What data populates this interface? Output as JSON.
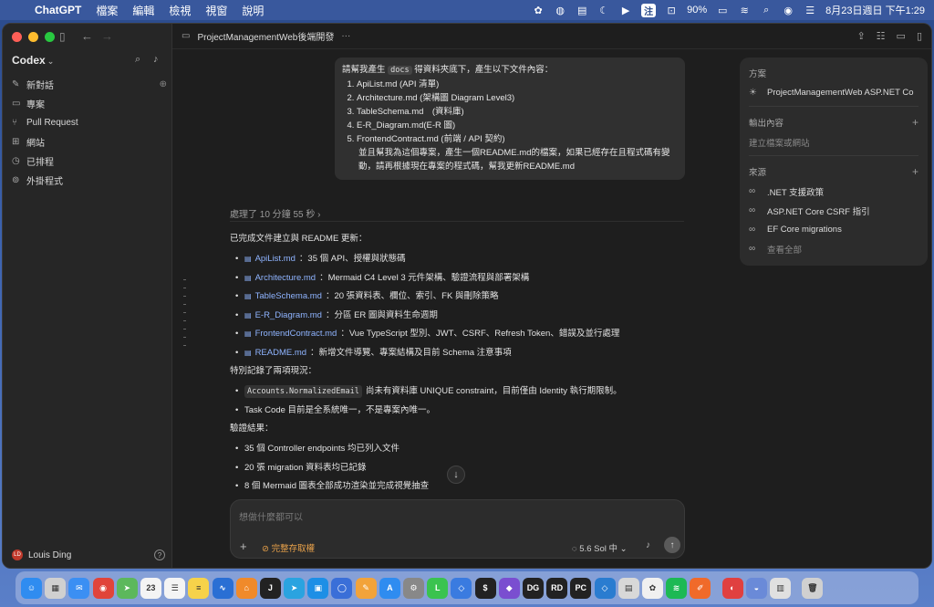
{
  "menubar": {
    "app": "ChatGPT",
    "menus": [
      "檔案",
      "編輯",
      "檢視",
      "視窗",
      "說明"
    ],
    "battery": "90%",
    "input_method": "注",
    "datetime": "8月23日週日 下午1:29"
  },
  "sidebar": {
    "title": "Codex",
    "items": [
      {
        "label": "新對話",
        "icon": "compose-icon"
      },
      {
        "label": "專案",
        "icon": "folder-icon"
      },
      {
        "label": "Pull Request",
        "icon": "pull-request-icon"
      },
      {
        "label": "網站",
        "icon": "grid-icon"
      },
      {
        "label": "已排程",
        "icon": "clock-icon"
      },
      {
        "label": "外掛程式",
        "icon": "plugin-icon"
      }
    ],
    "user": {
      "name": "Louis Ding",
      "initials": "LD"
    }
  },
  "topbar": {
    "title": "ProjectManagementWeb後端開發",
    "more": "···"
  },
  "user_message": {
    "intro_before": "請幫我產生",
    "intro_code": "docs",
    "intro_after": "得資料夾底下，產生以下文件內容：",
    "items": [
      "ApiList.md (API 清單)",
      "Architecture.md (架構圖 Diagram Level3)",
      "TableSchema.md　(資料庫)",
      "E-R_Diagram.md(E-R 圖)",
      "FrontendContract.md (前端 / API 契約)"
    ],
    "extra": "並且幫我為這個專案，產生一個README.md的檔案，如果已經存在且程式碼有變動，請再根據現在專案的程式碼，幫我更新README.md"
  },
  "processed": "處理了 10 分鐘 55 秒",
  "answer": {
    "intro": "已完成文件建立與 README 更新：",
    "files": [
      {
        "name": "ApiList.md",
        "desc": "：35 個 API、授權與狀態碼"
      },
      {
        "name": "Architecture.md",
        "desc": "：Mermaid C4 Level 3 元件架構、驗證流程與部署架構"
      },
      {
        "name": "TableSchema.md",
        "desc": "：20 張資料表、欄位、索引、FK 與刪除策略"
      },
      {
        "name": "E-R_Diagram.md",
        "desc": "：分區 ER 圖與資料生命週期"
      },
      {
        "name": "FrontendContract.md",
        "desc": "：Vue TypeScript 型別、JWT、CSRF、Refresh Token、錯誤及並行處理"
      },
      {
        "name": "README.md",
        "desc": "：新增文件導覽、專案結構及目前 Schema 注意事項"
      }
    ],
    "notes_title": "特別記錄了兩項現況：",
    "notes": [
      {
        "code": "Accounts.NormalizedEmail",
        "text": "尚未有資料庫 UNIQUE constraint，目前僅由 Identity 執行期限制。"
      },
      {
        "code": "",
        "text": "Task Code 目前是全系統唯一，不是專案內唯一。"
      }
    ],
    "verify_title": "驗證結果：",
    "verify": [
      "35 個 Controller endpoints 均已列入文件",
      "20 張 migration 資料表均已記錄",
      "8 個 Mermaid 圖表全部成功渲染並完成視覺抽查"
    ]
  },
  "composer": {
    "placeholder": "想做什麼都可以",
    "access": "完整存取權",
    "model": "5.6 Sol 中"
  },
  "panel": {
    "plan_title": "方案",
    "plan_item": "ProjectManagementWeb ASP.NET Co",
    "output_title": "輸出內容",
    "output_placeholder": "建立檔案或網站",
    "sources_title": "來源",
    "sources": [
      ".NET 支援政策",
      "ASP.NET Core CSRF 指引",
      "EF Core migrations"
    ],
    "view_all": "查看全部"
  },
  "dock": {
    "calendar_day": "23",
    "apps": [
      {
        "name": "finder",
        "color": "#2f8cf0",
        "glyph": "☺"
      },
      {
        "name": "launchpad",
        "color": "#d0d0d0",
        "glyph": "▦"
      },
      {
        "name": "mail",
        "color": "#3b8ff3",
        "glyph": "✉"
      },
      {
        "name": "chrome",
        "color": "#e0443a",
        "glyph": "◉"
      },
      {
        "name": "maps",
        "color": "#5cb85c",
        "glyph": "➤"
      },
      {
        "name": "calendar",
        "color": "#f4f4f4",
        "glyph": "23"
      },
      {
        "name": "reminders",
        "color": "#f4f4f4",
        "glyph": "☰"
      },
      {
        "name": "notes",
        "color": "#f6d24a",
        "glyph": "≡"
      },
      {
        "name": "freeform",
        "color": "#2a6fd4",
        "glyph": "∿"
      },
      {
        "name": "home",
        "color": "#f08a2a",
        "glyph": "⌂"
      },
      {
        "name": "jetbrains-j",
        "color": "#222",
        "glyph": "J"
      },
      {
        "name": "telegram",
        "color": "#2aa3e0",
        "glyph": "➤"
      },
      {
        "name": "docker",
        "color": "#1d8fe6",
        "glyph": "▣"
      },
      {
        "name": "outline",
        "color": "#3a6fd8",
        "glyph": "◯"
      },
      {
        "name": "pencil",
        "color": "#f2a33a",
        "glyph": "✎"
      },
      {
        "name": "app-store",
        "color": "#2f8cf0",
        "glyph": "A"
      },
      {
        "name": "system-settings",
        "color": "#888",
        "glyph": "⚙"
      },
      {
        "name": "line",
        "color": "#3ac34f",
        "glyph": "L"
      },
      {
        "name": "vscode-insiders",
        "color": "#3a7be0",
        "glyph": "◇"
      },
      {
        "name": "terminal",
        "color": "#222",
        "glyph": "$"
      },
      {
        "name": "obsidian",
        "color": "#7a4ed0",
        "glyph": "◆"
      },
      {
        "name": "datagrip",
        "color": "#222",
        "glyph": "DG"
      },
      {
        "name": "rider",
        "color": "#222",
        "glyph": "RD"
      },
      {
        "name": "pycharm",
        "color": "#222",
        "glyph": "PC"
      },
      {
        "name": "vscode",
        "color": "#2a7cd0",
        "glyph": "◇"
      },
      {
        "name": "preview",
        "color": "#d8d8d8",
        "glyph": "▤"
      },
      {
        "name": "chatgpt",
        "color": "#f0f0f0",
        "glyph": "✿"
      },
      {
        "name": "spotify",
        "color": "#1db954",
        "glyph": "≋"
      },
      {
        "name": "craft",
        "color": "#f06a2a",
        "glyph": "✐"
      },
      {
        "name": "photo-booth",
        "color": "#e04040",
        "glyph": "◐"
      },
      {
        "name": "disk-utility",
        "color": "#6a8ad8",
        "glyph": "◒"
      },
      {
        "name": "finder-2",
        "color": "#e0e0e0",
        "glyph": "▥"
      },
      {
        "name": "trash",
        "color": "#d0d0d0",
        "glyph": "🗑"
      }
    ]
  }
}
